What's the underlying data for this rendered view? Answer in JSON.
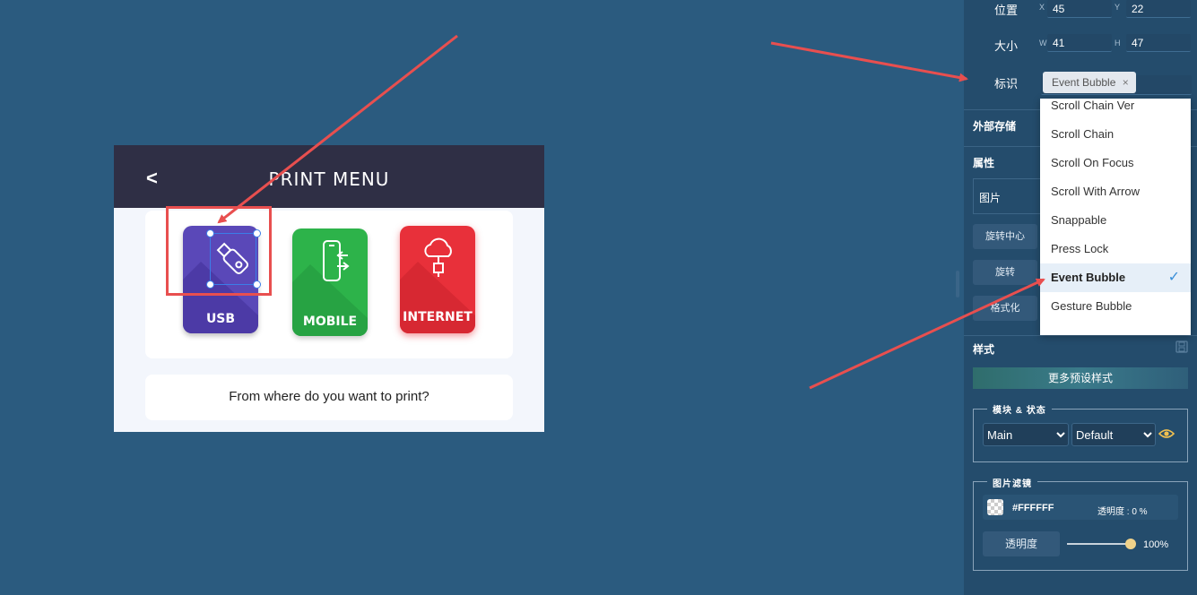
{
  "artboard": {
    "back_label": "<",
    "title": "PRINT MENU",
    "tiles": [
      {
        "label": "USB",
        "color": "#5a48b8"
      },
      {
        "label": "MOBILE",
        "color": "#2db34a"
      },
      {
        "label": "INTERNET",
        "color": "#e8303a"
      }
    ],
    "question": "From where do you want to print?"
  },
  "panel": {
    "position": {
      "label": "位置",
      "x_label": "X",
      "x_value": "45",
      "y_label": "Y",
      "y_value": "22"
    },
    "size": {
      "label": "大小",
      "w_label": "W",
      "w_value": "41",
      "h_label": "H",
      "h_value": "47"
    },
    "identifier": {
      "label": "标识",
      "tag": "Event Bubble",
      "tag_close": "×"
    },
    "external_storage": "外部存储",
    "properties": "属性",
    "type_value": "图片",
    "rotate_center": "旋转中心",
    "rotate": "旋转",
    "format": "格式化",
    "style": "样式",
    "more_presets": "更多预设样式",
    "module_state": {
      "legend": "模块 & 状态",
      "module": "Main",
      "state": "Default"
    },
    "image_filter": {
      "legend": "图片滤镜",
      "color": "#FFFFFF",
      "opacity_text": "透明度 : 0 %",
      "opacity_button": "透明度",
      "opacity_percent": "100%",
      "opacity_level": 1.0
    }
  },
  "dropdown": {
    "items": [
      "Scroll Chain Ver",
      "Scroll Chain",
      "Scroll On Focus",
      "Scroll With Arrow",
      "Snappable",
      "Press Lock",
      "Event Bubble",
      "Gesture Bubble",
      "..."
    ],
    "selected": "Event Bubble",
    "check": "✓"
  },
  "colors": {
    "background": "#2b5b7f",
    "panel": "#244c6c",
    "annotation": "#e84f4f",
    "selection": "#3b7de8"
  }
}
